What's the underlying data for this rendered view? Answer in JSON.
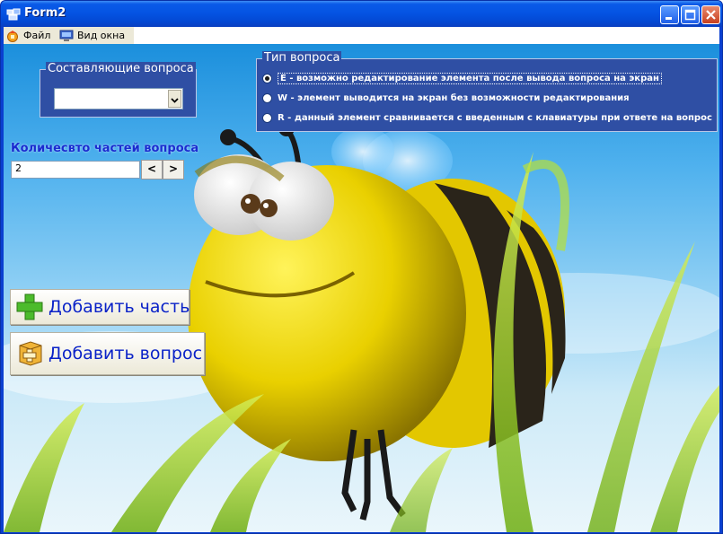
{
  "window": {
    "title": "Form2",
    "colors": {
      "titlebar": "#0554e3",
      "client_sky": "#4fb1ee",
      "groupbox": "#2f4fa4",
      "accent_text": "#1a2bd0"
    }
  },
  "menu": {
    "items": [
      {
        "label": "Файл",
        "icon": "file-menu-icon"
      },
      {
        "label": "Вид окна",
        "icon": "monitor-icon"
      }
    ]
  },
  "components": {
    "title": "Составляющие вопроса",
    "selected": ""
  },
  "question_type": {
    "title": "Тип вопроса",
    "options": [
      {
        "label": "E - возможно редактирование элемента после вывода вопроса на экран",
        "checked": true
      },
      {
        "label": "W - элемент выводится на экран без возможности редактирования",
        "checked": false
      },
      {
        "label": "R - данный элемент сравнивается с введенным с клавиатуры при ответе на вопрос",
        "checked": false
      }
    ]
  },
  "parts": {
    "label": "Количесвто частей вопроса",
    "value": "2",
    "prev": "<",
    "next": ">"
  },
  "buttons": {
    "add_part": "Добавить часть",
    "add_question": "Добавить вопрос"
  }
}
